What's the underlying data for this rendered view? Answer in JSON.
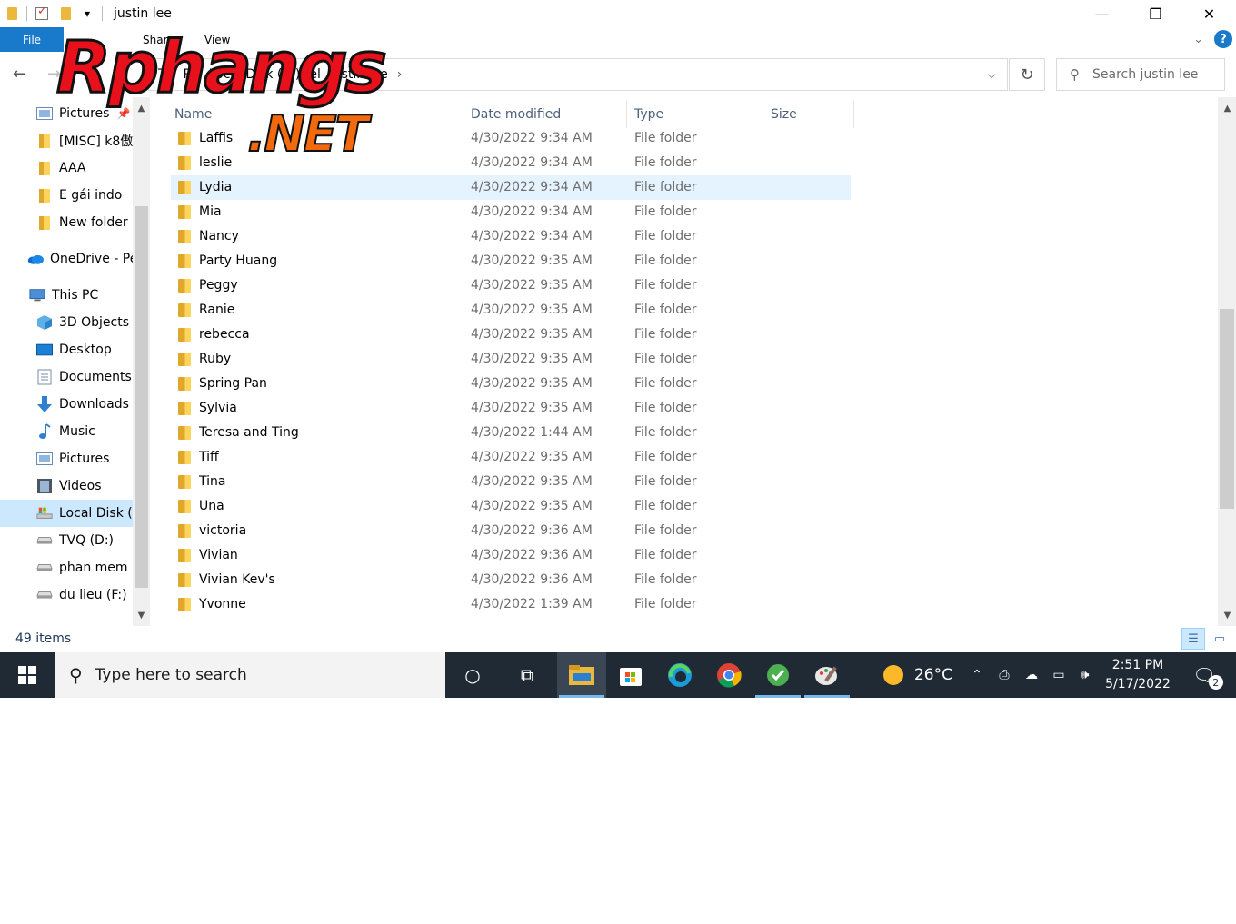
{
  "window": {
    "title": "justin lee",
    "controls": [
      "—",
      "❐",
      "✕"
    ]
  },
  "ribbon": {
    "file_tab": "File",
    "tabs": [
      "Share",
      "View"
    ]
  },
  "address": {
    "crumbs": [
      "Th",
      "PC",
      "Local Disk (C:)",
      "el",
      "justin lee"
    ],
    "search_placeholder": "Search justin lee"
  },
  "nav": {
    "items": [
      {
        "label": "Pictures",
        "icon": "pictures-icon"
      },
      {
        "label": "[MISC] k8傲",
        "icon": "folder-icon"
      },
      {
        "label": "AAA",
        "icon": "folder-icon"
      },
      {
        "label": "E gái indo",
        "icon": "folder-icon"
      },
      {
        "label": "New folder",
        "icon": "folder-icon"
      },
      {
        "label": "OneDrive - Pe",
        "icon": "onedrive-icon"
      },
      {
        "label": "This PC",
        "icon": "computer-icon"
      },
      {
        "label": "3D Objects",
        "icon": "3d-objects-icon"
      },
      {
        "label": "Desktop",
        "icon": "desktop-icon"
      },
      {
        "label": "Documents",
        "icon": "documents-icon"
      },
      {
        "label": "Downloads",
        "icon": "downloads-icon"
      },
      {
        "label": "Music",
        "icon": "music-icon"
      },
      {
        "label": "Pictures",
        "icon": "pictures-icon"
      },
      {
        "label": "Videos",
        "icon": "videos-icon"
      },
      {
        "label": "Local Disk (C",
        "icon": "local-disk-icon"
      },
      {
        "label": "TVQ (D:)",
        "icon": "drive-icon"
      },
      {
        "label": "phan mem (",
        "icon": "drive-icon"
      },
      {
        "label": "du lieu (F:)",
        "icon": "drive-icon"
      }
    ],
    "selected_index": 14
  },
  "columns": {
    "name": "Name",
    "date": "Date modified",
    "type": "Type",
    "size": "Size"
  },
  "files": [
    {
      "name": "Laffis",
      "date": "4/30/2022 9:34 AM",
      "type": "File folder"
    },
    {
      "name": "leslie",
      "date": "4/30/2022 9:34 AM",
      "type": "File folder"
    },
    {
      "name": "Lydia",
      "date": "4/30/2022 9:34 AM",
      "type": "File folder"
    },
    {
      "name": "Mia",
      "date": "4/30/2022 9:34 AM",
      "type": "File folder"
    },
    {
      "name": "Nancy",
      "date": "4/30/2022 9:34 AM",
      "type": "File folder"
    },
    {
      "name": "Party Huang",
      "date": "4/30/2022 9:35 AM",
      "type": "File folder"
    },
    {
      "name": "Peggy",
      "date": "4/30/2022 9:35 AM",
      "type": "File folder"
    },
    {
      "name": "Ranie",
      "date": "4/30/2022 9:35 AM",
      "type": "File folder"
    },
    {
      "name": "rebecca",
      "date": "4/30/2022 9:35 AM",
      "type": "File folder"
    },
    {
      "name": "Ruby",
      "date": "4/30/2022 9:35 AM",
      "type": "File folder"
    },
    {
      "name": "Spring Pan",
      "date": "4/30/2022 9:35 AM",
      "type": "File folder"
    },
    {
      "name": "Sylvia",
      "date": "4/30/2022 9:35 AM",
      "type": "File folder"
    },
    {
      "name": "Teresa and Ting",
      "date": "4/30/2022 1:44 AM",
      "type": "File folder"
    },
    {
      "name": "Tiff",
      "date": "4/30/2022 9:35 AM",
      "type": "File folder"
    },
    {
      "name": "Tina",
      "date": "4/30/2022 9:35 AM",
      "type": "File folder"
    },
    {
      "name": "Una",
      "date": "4/30/2022 9:35 AM",
      "type": "File folder"
    },
    {
      "name": "victoria",
      "date": "4/30/2022 9:36 AM",
      "type": "File folder"
    },
    {
      "name": "Vivian",
      "date": "4/30/2022 9:36 AM",
      "type": "File folder"
    },
    {
      "name": "Vivian Kev's",
      "date": "4/30/2022 9:36 AM",
      "type": "File folder"
    },
    {
      "name": "Yvonne",
      "date": "4/30/2022 1:39 AM",
      "type": "File folder"
    }
  ],
  "selected_file_index": 2,
  "status": {
    "count": "49 items"
  },
  "taskbar": {
    "search_placeholder": "Type here to search",
    "weather": "26°C",
    "time": "2:51 PM",
    "date": "5/17/2022",
    "notifications": "2"
  },
  "watermark": {
    "top": "Rphangs",
    "bottom": ".NET"
  },
  "colors": {
    "accent": "#1979ca",
    "selection": "#e5f3ff",
    "taskbar": "#1f2a35",
    "folder": "#e9b83c"
  }
}
